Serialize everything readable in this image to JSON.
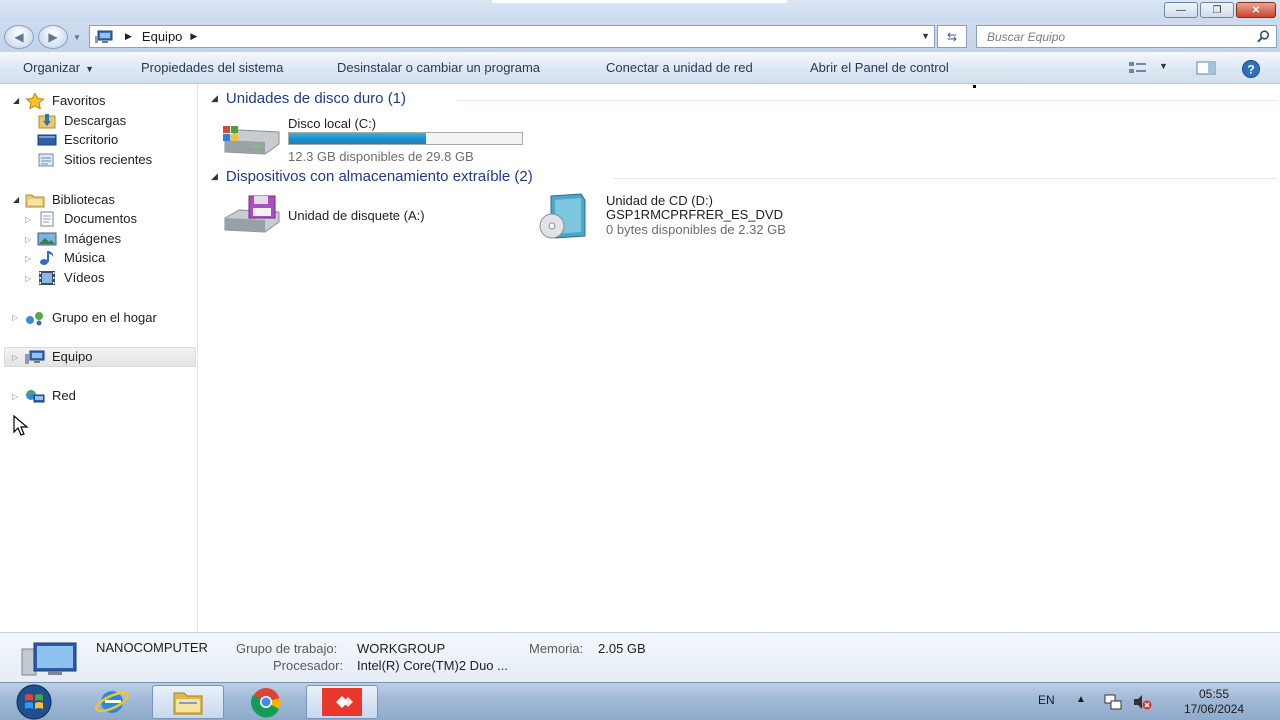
{
  "window": {
    "buttons": {
      "minimize": "—",
      "maximize": "❐",
      "close": "✕"
    }
  },
  "address": {
    "crumbs": [
      "Equipo"
    ],
    "search_placeholder": "Buscar Equipo"
  },
  "commandbar": {
    "organize": "Organizar",
    "system_properties": "Propiedades del sistema",
    "uninstall": "Desinstalar o cambiar un programa",
    "map_drive": "Conectar a unidad de red",
    "control_panel": "Abrir el Panel de control"
  },
  "nav": {
    "favorites": "Favoritos",
    "downloads": "Descargas",
    "desktop": "Escritorio",
    "recent": "Sitios recientes",
    "libraries": "Bibliotecas",
    "documents": "Documentos",
    "images": "Imágenes",
    "music": "Música",
    "videos": "Vídeos",
    "homegroup": "Grupo en el hogar",
    "computer": "Equipo",
    "network": "Red"
  },
  "content": {
    "hdd_group": "Unidades de disco duro (1)",
    "removable_group": "Dispositivos con almacenamiento extraíble (2)",
    "local_disk": {
      "name": "Disco local (C:)",
      "free": "12.3 GB disponibles de 29.8 GB",
      "used_fraction": 0.587
    },
    "floppy": {
      "name": "Unidad de disquete (A:)"
    },
    "cd": {
      "name": "Unidad de CD (D:)",
      "label": "GSP1RMCPRFRER_ES_DVD",
      "free": "0 bytes disponibles de 2.32 GB"
    }
  },
  "details": {
    "computer_name": "NANOCOMPUTER",
    "workgroup_key": "Grupo de trabajo:",
    "workgroup_val": "WORKGROUP",
    "memory_key": "Memoria:",
    "memory_val": "2.05 GB",
    "processor_key": "Procesador:",
    "processor_val": "Intel(R) Core(TM)2 Duo ..."
  },
  "taskbar": {
    "lang": "EN",
    "time": "05:55",
    "date": "17/06/2024"
  },
  "colors": {
    "group_heading": "#1e3b8a",
    "command_text": "#1e395b",
    "progress": "#1f8fcc"
  }
}
